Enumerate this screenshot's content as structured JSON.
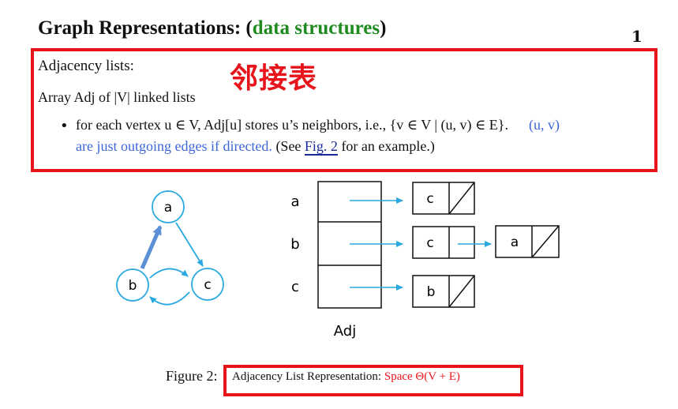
{
  "header": {
    "title_main": "Graph Representations: (",
    "title_green": "data structures",
    "title_close": ")",
    "corner_mark": "1"
  },
  "section": {
    "heading": "Adjacency lists:",
    "annotation_cn": "邻接表",
    "array_line": "Array Adj of |V| linked lists",
    "bullet_line1_a": "for each vertex u ∈ V, Adj[u] stores u’s neighbors, i.e., {v ∈ V | (u, v) ∈ E}.",
    "bullet_line1_b": "(u, v)",
    "bullet_line2_blue": "are just outgoing edges if directed.",
    "bullet_line2_pre": "(See ",
    "bullet_line2_link": "Fig. 2",
    "bullet_line2_post": " for an example.)"
  },
  "graph": {
    "nodes": [
      "a",
      "b",
      "c"
    ],
    "edges": [
      {
        "from": "b",
        "to": "a",
        "style": "bold"
      },
      {
        "from": "a",
        "to": "c",
        "style": "normal"
      },
      {
        "from": "b",
        "to": "c",
        "style": "curved"
      },
      {
        "from": "c",
        "to": "b",
        "style": "curved"
      }
    ]
  },
  "adjacency": {
    "array_label": "Adj",
    "rows": [
      {
        "vertex": "a",
        "list": [
          "c"
        ]
      },
      {
        "vertex": "b",
        "list": [
          "c",
          "a"
        ]
      },
      {
        "vertex": "c",
        "list": [
          "b"
        ]
      }
    ]
  },
  "caption": {
    "label": "Figure 2:",
    "text": "Adjacency List Representation: ",
    "space": "Space Θ(V + E)"
  },
  "colors": {
    "highlight_red": "#e8141b",
    "title_green": "#1f8a1f",
    "note_blue": "#3d66d9",
    "graph_blue": "#29a9e0",
    "bold_edge_blue": "#5b8fd6"
  }
}
